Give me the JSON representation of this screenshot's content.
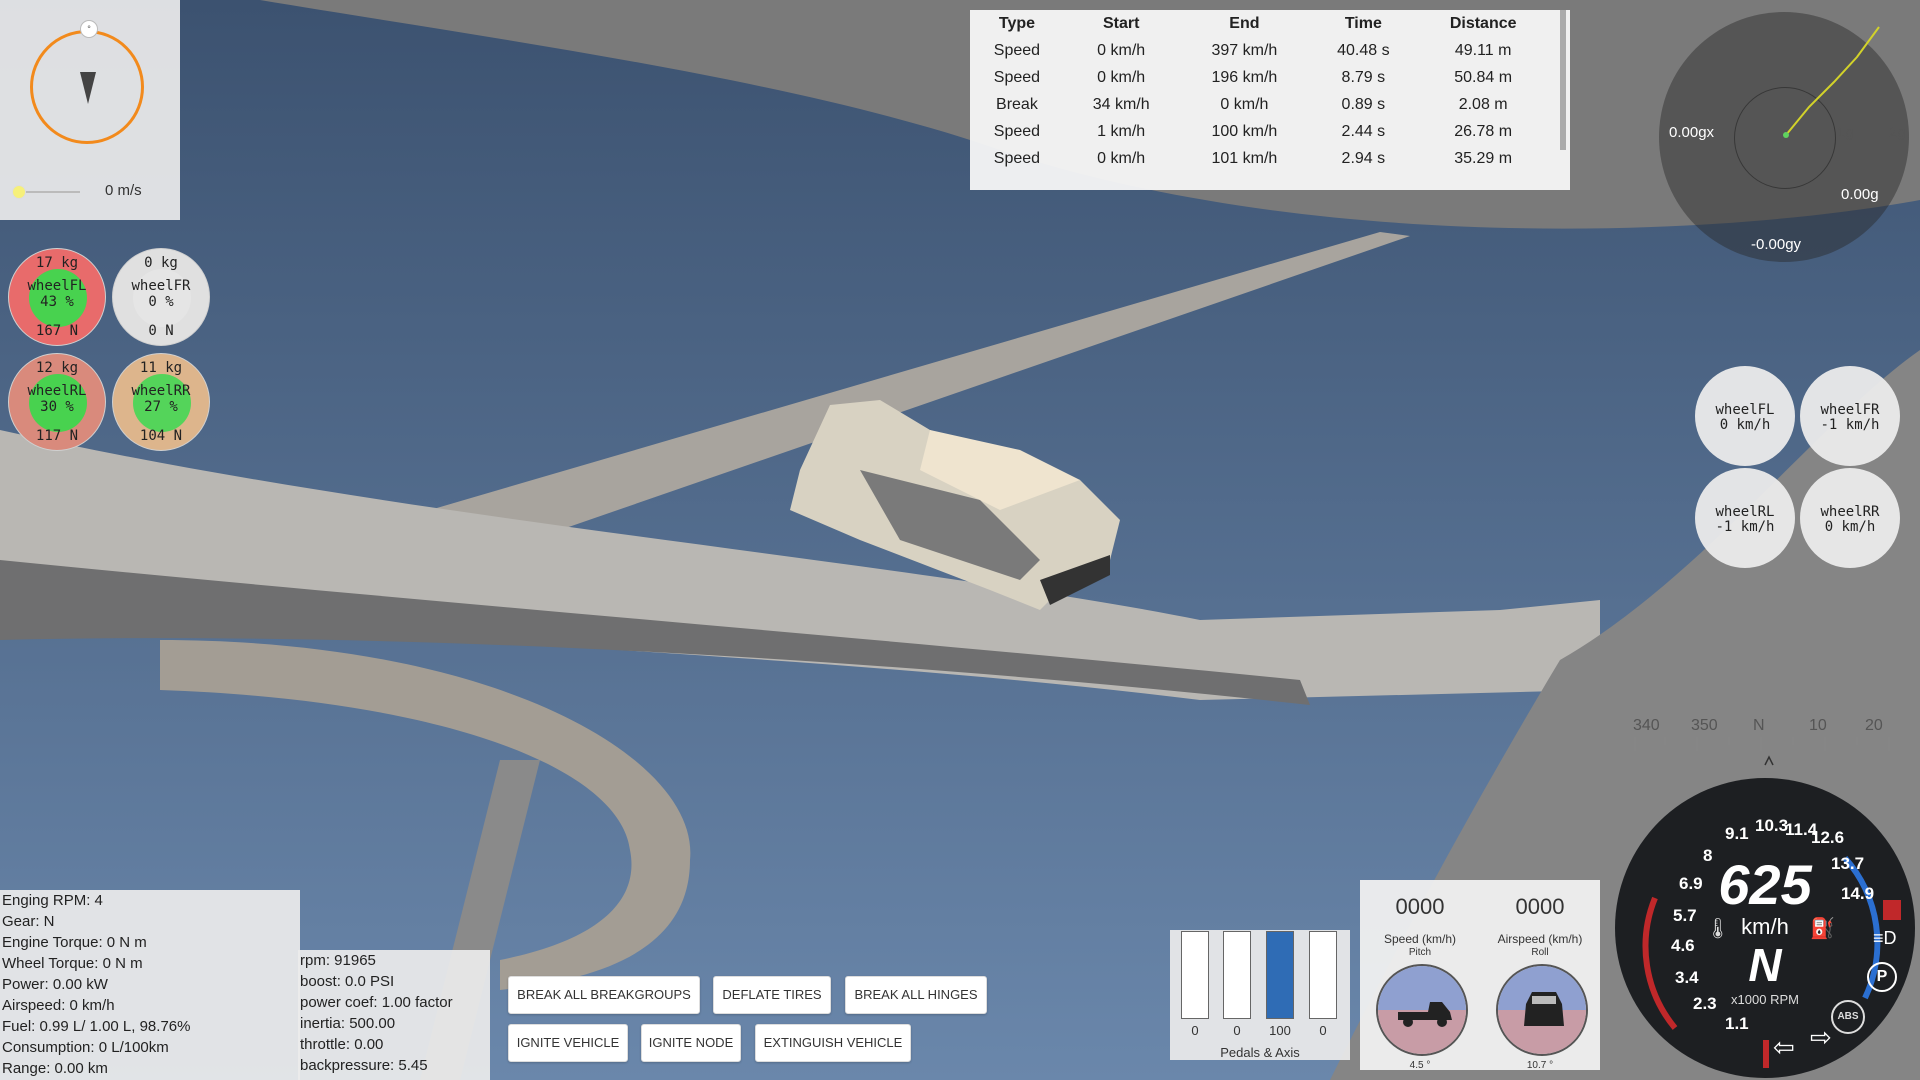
{
  "compass": {
    "speed": "0 m/s",
    "knob": "°"
  },
  "wheel_loads": [
    {
      "id": "FL",
      "mass": "17  kg",
      "label": "wheelFL",
      "pct": "43 %",
      "force": "167  N",
      "color": "#48d24f",
      "ring": "#e86b6b"
    },
    {
      "id": "FR",
      "mass": "0  kg",
      "label": "wheelFR",
      "pct": "0 %",
      "force": "0  N",
      "color": "#e5e5e5",
      "ring": "#e0e0e0"
    },
    {
      "id": "RL",
      "mass": "12  kg",
      "label": "wheelRL",
      "pct": "30 %",
      "force": "117  N",
      "color": "#48d24f",
      "ring": "#d98a7c"
    },
    {
      "id": "RR",
      "mass": "11  kg",
      "label": "wheelRR",
      "pct": "27 %",
      "force": "104  N",
      "color": "#54d45a",
      "ring": "#ddb58c"
    }
  ],
  "wheel_speeds": [
    {
      "label": "wheelFL",
      "speed": "0 km/h"
    },
    {
      "label": "wheelFR",
      "speed": "-1 km/h"
    },
    {
      "label": "wheelRL",
      "speed": "-1 km/h"
    },
    {
      "label": "wheelRR",
      "speed": "0 km/h"
    }
  ],
  "results": {
    "headers": [
      "Type",
      "Start",
      "End",
      "Time",
      "Distance"
    ],
    "rows": [
      [
        "Speed",
        "0 km/h",
        "397 km/h",
        "40.48 s",
        "49.11 m"
      ],
      [
        "Speed",
        "0 km/h",
        "196 km/h",
        "8.79 s",
        "50.84 m"
      ],
      [
        "Break",
        "34 km/h",
        "0 km/h",
        "0.89 s",
        "2.08 m"
      ],
      [
        "Speed",
        "1 km/h",
        "100 km/h",
        "2.44 s",
        "26.78 m"
      ],
      [
        "Speed",
        "0 km/h",
        "101 km/h",
        "2.94 s",
        "35.29 m"
      ]
    ]
  },
  "gmeter": {
    "gx": "0.00gx",
    "gy": "-0.00gy",
    "g": "0.00g",
    "ring1": "1g",
    "ring2": "2g"
  },
  "engine": [
    "Enging RPM: 4",
    "Gear: N",
    "Engine Torque: 0 N m",
    "Wheel Torque: 0 N m",
    "Power: 0.00 kW",
    "Airspeed: 0 km/h",
    "Fuel: 0.99 L/ 1.00 L, 98.76%",
    "Consumption: 0 L/100km",
    "Range: 0.00 km"
  ],
  "boost": [
    "rpm: 91965",
    "boost: 0.0 PSI",
    "power coef: 1.00 factor",
    "inertia: 500.00",
    "throttle: 0.00",
    "backpressure: 5.45"
  ],
  "buttons": {
    "break_groups": "BREAK ALL BREAKGROUPS",
    "deflate": "DEFLATE TIRES",
    "break_hinges": "BREAK ALL HINGES",
    "ignite_vehicle": "IGNITE VEHICLE",
    "ignite_node": "IGNITE NODE",
    "extinguish": "EXTINGUISH VEHICLE"
  },
  "pedals": {
    "values": [
      "0",
      "0",
      "100",
      "0"
    ],
    "levels": [
      0,
      0,
      1,
      0
    ],
    "title": "Pedals & Axis"
  },
  "attitude": {
    "speed_val": "0000",
    "speed_lbl": "Speed (km/h)",
    "pitch_lbl": "Pitch",
    "pitch_val": "4.5 °",
    "air_val": "0000",
    "air_lbl": "Airspeed (km/h)",
    "roll_lbl": "Roll",
    "roll_val": "10.7 °"
  },
  "heading": {
    "ticks": [
      "340",
      "350",
      "N",
      "10",
      "20"
    ]
  },
  "speedo": {
    "speed": "625",
    "unit": "km/h",
    "gear": "N",
    "rpm_unit": "x1000 RPM",
    "scale": [
      "1.1",
      "2.3",
      "3.4",
      "4.6",
      "5.7",
      "6.9",
      "8",
      "9.1",
      "10.3",
      "11.4",
      "12.6",
      "13.7",
      "14.9"
    ],
    "abs": "ABS",
    "park": "P"
  }
}
